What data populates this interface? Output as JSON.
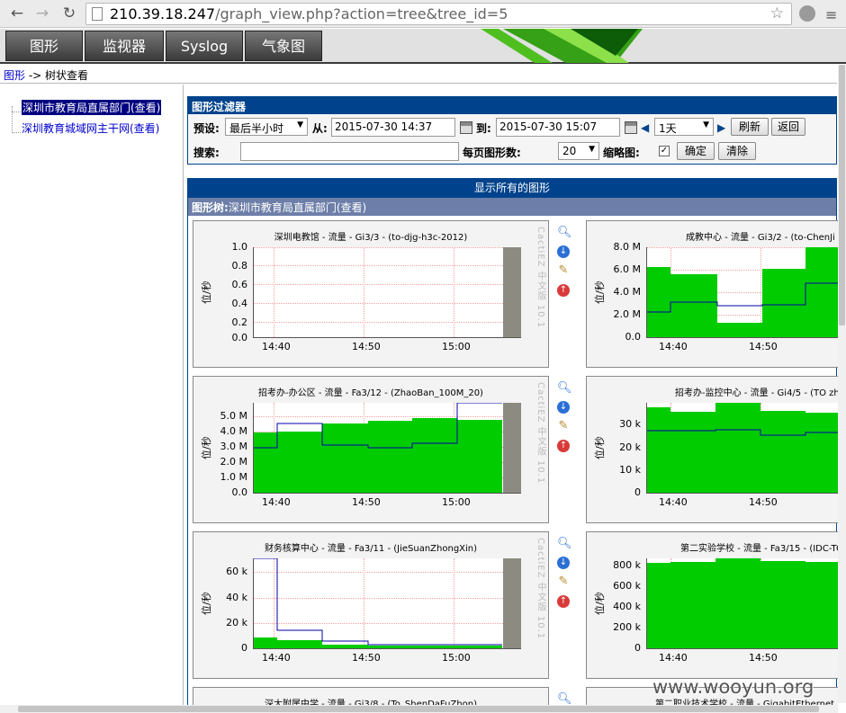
{
  "browser": {
    "back_icon": "back-arrow-icon",
    "forward_icon": "forward-arrow-icon",
    "reload_icon": "reload-icon",
    "url_host": "210.39.18.247",
    "url_path": "/graph_view.php?action=tree&tree_id=5",
    "star_icon": "star-icon"
  },
  "tabs": [
    "图形",
    "监视器",
    "Syslog",
    "气象图"
  ],
  "breadcrumb": {
    "link": "图形",
    "sep": " -> ",
    "current": "树状查看"
  },
  "tree": {
    "items": [
      {
        "label": "深圳市教育局直属部门(查看)",
        "selected": true
      },
      {
        "label": "深圳教育城域网主干网(查看)",
        "selected": false
      }
    ]
  },
  "filter": {
    "title": "图形过滤器",
    "preset_label": "预设:",
    "preset_value": "最后半小时",
    "from_label": "从:",
    "from_value": "2015-07-30 14:37",
    "to_label": "到:",
    "to_value": "2015-07-30 15:07",
    "span_value": "1天",
    "refresh": "刷新",
    "back": "返回",
    "search_label": "搜索:",
    "search_value": "",
    "per_page_label": "每页图形数:",
    "per_page_value": "20",
    "thumb_label": "缩略图:",
    "confirm": "确定",
    "clear": "清除"
  },
  "graphs_header": "显示所有的图形",
  "tree_header": {
    "prefix": "图形树:",
    "name": "深圳市教育局直属部门(查看)"
  },
  "watermark_side": "CactiEZ 中文版 10.1",
  "site_watermark": "www.wooyun.org",
  "ylabel": "位/秒",
  "graphs": [
    {
      "title": "深圳电教馆 - 流量 - Gi3/3 - (to-djg-h3c-2012)",
      "yticks": [
        "1.0",
        "0.8",
        "0.6",
        "0.4",
        "0.2",
        "0.0"
      ],
      "xticks": [
        "14:40",
        "14:50",
        "15:00"
      ]
    },
    {
      "title": "成教中心 - 流量 - Gi3/2 - (to-ChenJi",
      "yticks": [
        "8.0 M",
        "6.0 M",
        "4.0 M",
        "2.0 M",
        "0.0"
      ],
      "xticks": [
        "14:40",
        "14:50"
      ]
    },
    {
      "title": "招考办-办公区 - 流量 - Fa3/12 - (ZhaoBan_100M_20)",
      "yticks": [
        "5.0 M",
        "4.0 M",
        "3.0 M",
        "2.0 M",
        "1.0 M",
        "0.0"
      ],
      "xticks": [
        "14:40",
        "14:50",
        "15:00"
      ]
    },
    {
      "title": "招考办-监控中心 - 流量 - Gi4/5 - (TO zh",
      "yticks": [
        "30 k",
        "20 k",
        "10 k",
        "0"
      ],
      "xticks": [
        "14:40",
        "14:50"
      ]
    },
    {
      "title": "财务核算中心 - 流量 - Fa3/11 - (JieSuanZhongXin)",
      "yticks": [
        "60 k",
        "40 k",
        "20 k",
        "0"
      ],
      "xticks": [
        "14:40",
        "14:50",
        "15:00"
      ]
    },
    {
      "title": "第二实验学校 - 流量 - Fa3/15 - (IDC-TC",
      "yticks": [
        "800 k",
        "600 k",
        "400 k",
        "200 k",
        "0"
      ],
      "xticks": [
        "14:40",
        "14:50"
      ]
    },
    {
      "title": "深大附属中学 - 流量 - Gi3/8 - (To_ShenDaFuZhon)",
      "yticks": [],
      "xticks": []
    },
    {
      "title": "第二职业技术学校 - 流量 - GigabitEthernet",
      "yticks": [],
      "xticks": []
    }
  ],
  "colors": {
    "inbound": "#00cc00",
    "outbound": "#0000aa",
    "header": "#00438c"
  }
}
